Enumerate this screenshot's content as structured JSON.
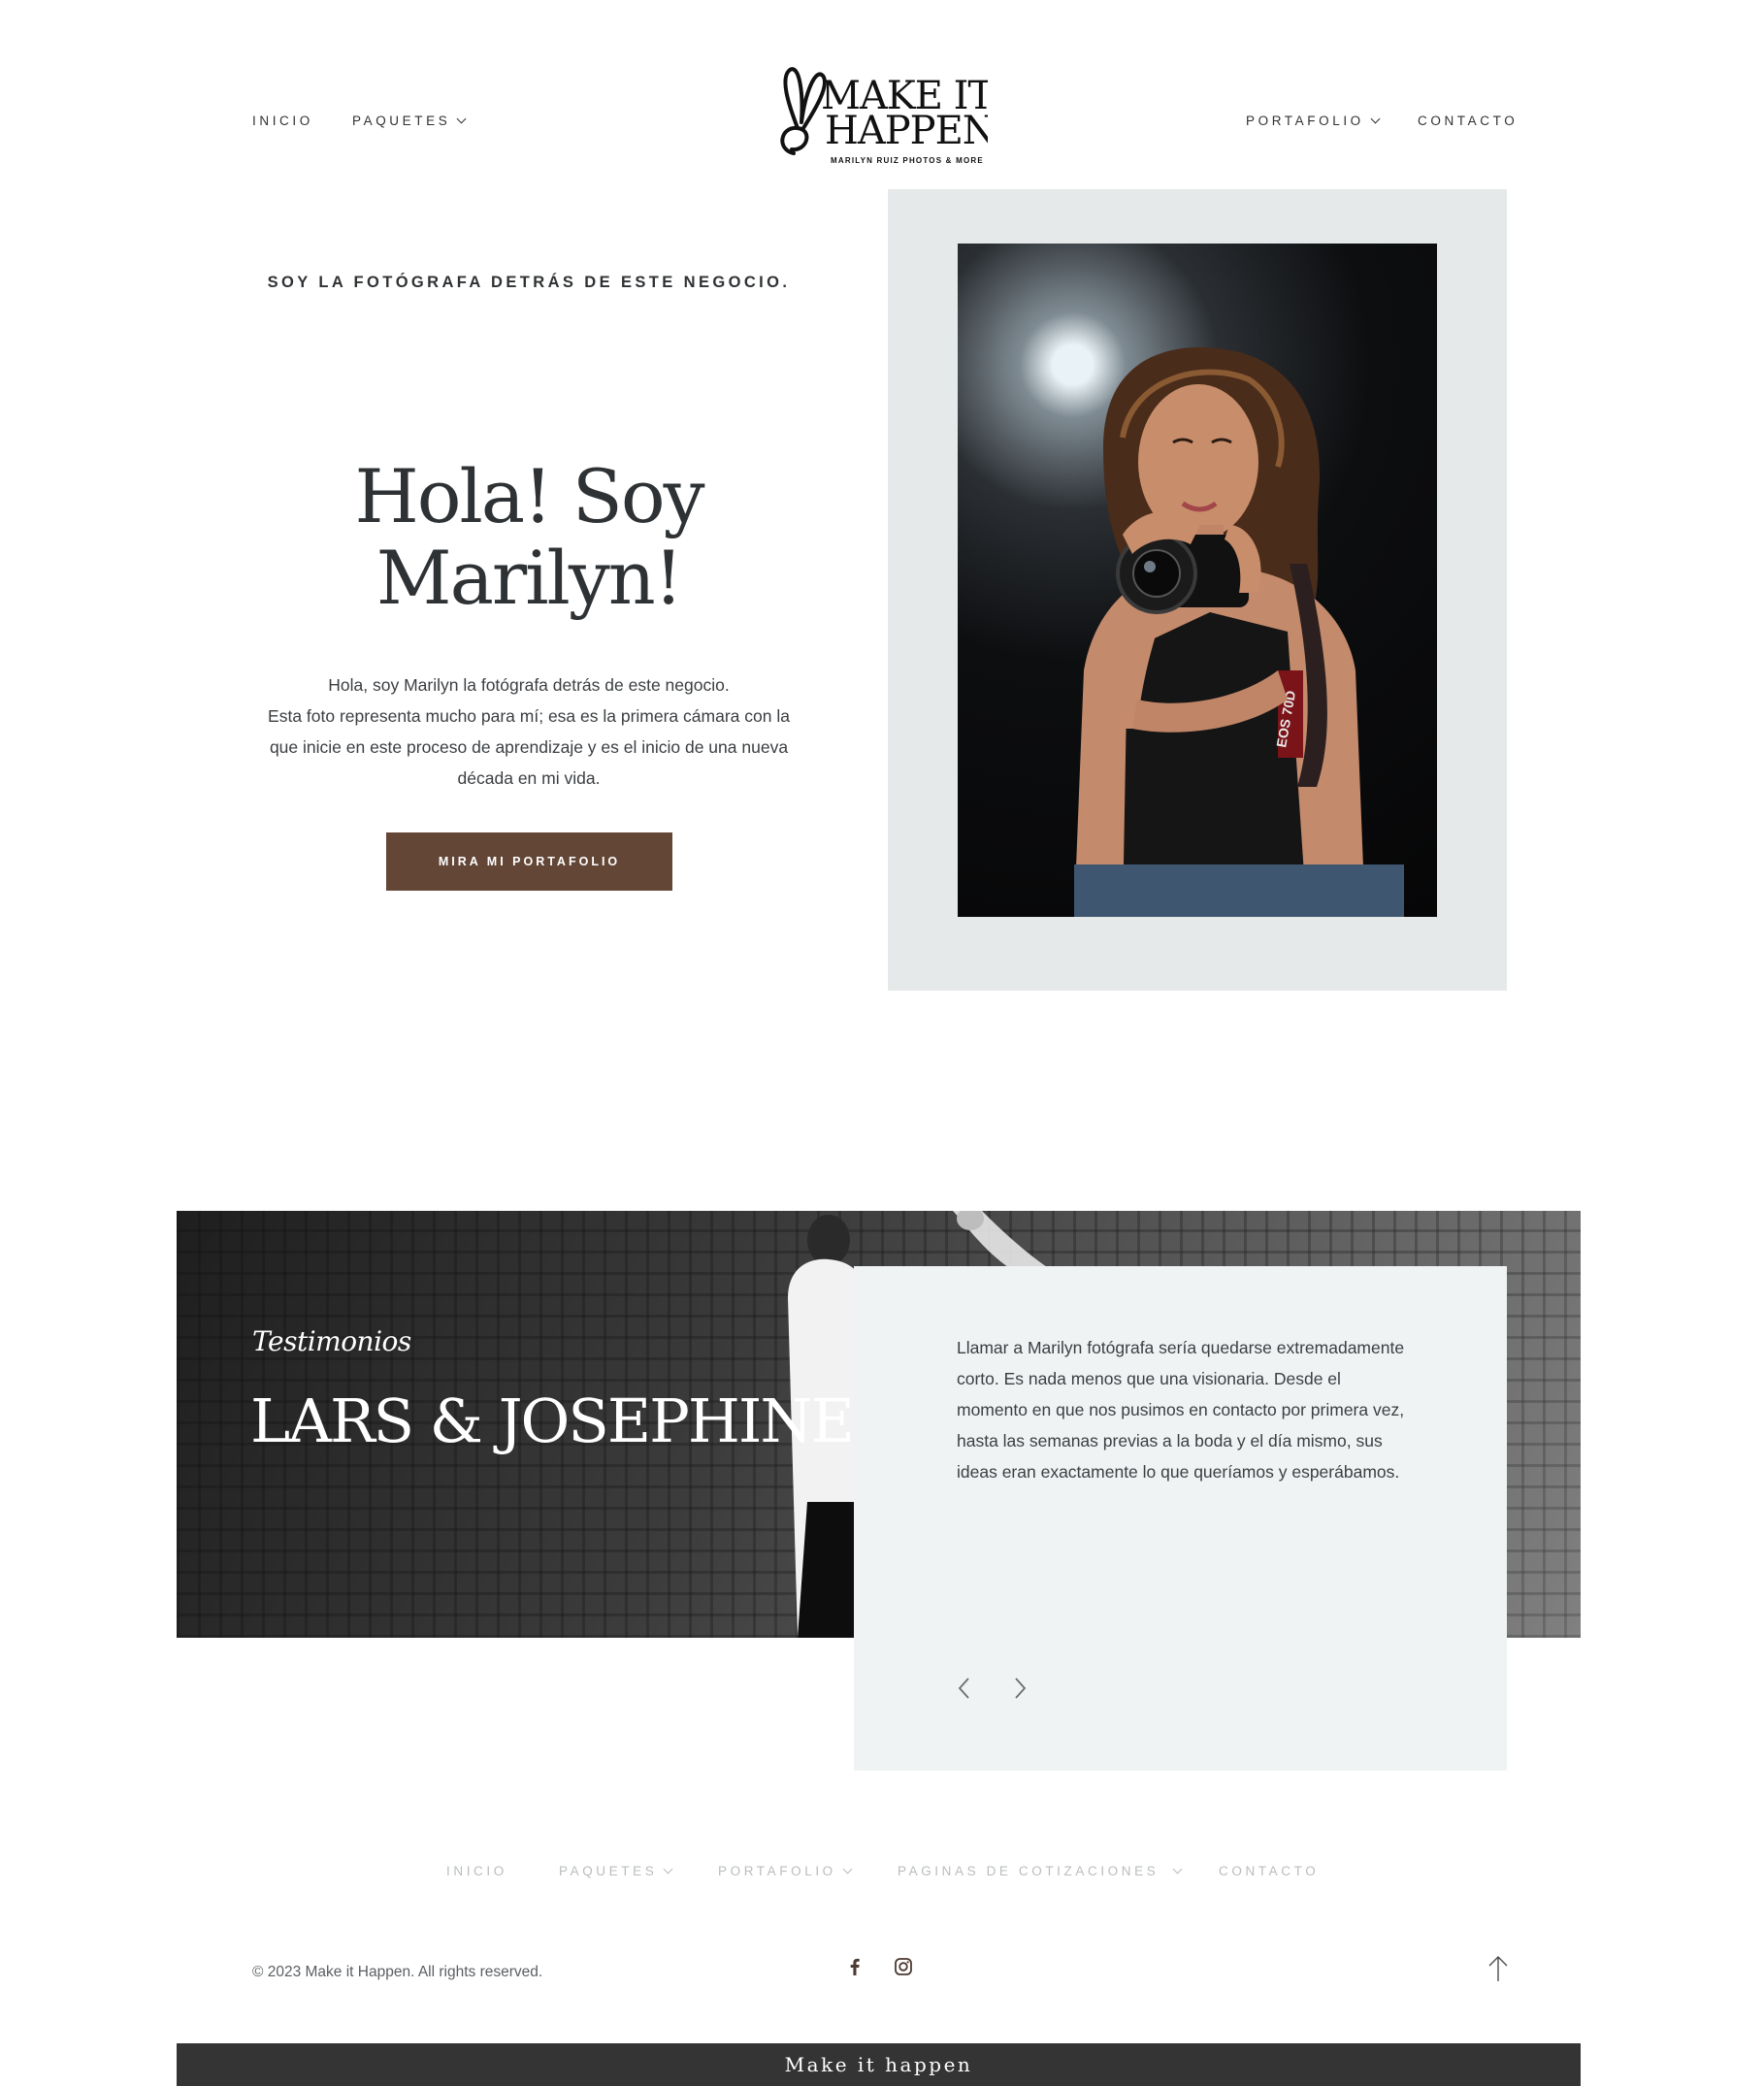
{
  "header": {
    "nav_left": [
      {
        "label": "INICIO"
      },
      {
        "label": "PAQUETES",
        "has_dropdown": true
      }
    ],
    "nav_right": [
      {
        "label": "PORTAFOLIO",
        "has_dropdown": true
      },
      {
        "label": "CONTACTO"
      }
    ],
    "logo": {
      "line1": "MAKE IT",
      "line2": "HAPPEN",
      "tagline": "MARILYN RUIZ PHOTOS & MORE"
    }
  },
  "hero": {
    "eyebrow": "SOY LA FOTÓGRAFA DETRÁS DE ESTE NEGOCIO.",
    "title": "Hola! Soy Marilyn!",
    "body": "Hola, soy Marilyn la fotógrafa detrás de este negocio.\nEsta foto representa mucho para mí; esa es la primera cámara con la que inicie en este proceso de aprendizaje y es el inicio de una nueva década en mi vida.",
    "cta_label": "MIRA MI PORTAFOLIO",
    "photo_camera_text": "EOS 70D"
  },
  "testimonials": {
    "label": "Testimonios",
    "name": "LARS & JOSEPHINE",
    "quote": "Llamar a Marilyn fotógrafa sería quedarse extremadamente corto. Es nada menos que una visionaria. Desde el momento en que nos pusimos en contacto por primera vez, hasta las semanas previas a la boda y el día mismo, sus ideas eran exactamente lo que queríamos y esperábamos.",
    "prev_icon": "chevron-left-icon",
    "next_icon": "chevron-right-icon"
  },
  "footer": {
    "nav": [
      {
        "label": "INICIO"
      },
      {
        "label": "PAQUETES",
        "has_dropdown": true
      },
      {
        "label": "PORTAFOLIO",
        "has_dropdown": true
      },
      {
        "label": "PAGINAS DE COTIZACIONES",
        "has_dropdown": true
      },
      {
        "label": "CONTACTO"
      }
    ],
    "copyright": "© 2023 Make it Happen. All rights reserved.",
    "social": [
      {
        "icon": "facebook-icon"
      },
      {
        "icon": "instagram-icon"
      }
    ],
    "back_to_top_icon": "arrow-up-icon",
    "bottom_bar": "Make it happen"
  },
  "colors": {
    "text": "#2f3234",
    "accent": "#634636",
    "frame": "#e6e9ea",
    "card": "#f0f3f4",
    "footer_nav": "#b9bcbe",
    "bottom_bar": "#343434"
  }
}
